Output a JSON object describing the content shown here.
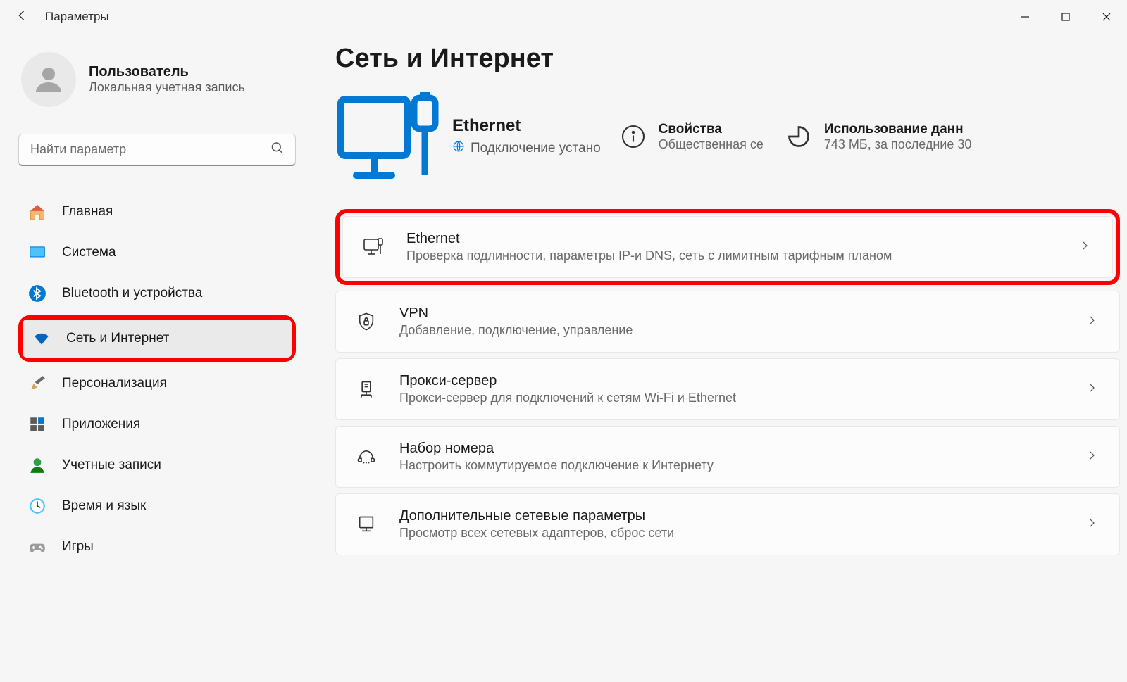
{
  "window": {
    "title": "Параметры"
  },
  "user": {
    "name": "Пользователь",
    "subtitle": "Локальная учетная запись"
  },
  "search": {
    "placeholder": "Найти параметр"
  },
  "nav": [
    {
      "label": "Главная",
      "icon": "home"
    },
    {
      "label": "Система",
      "icon": "system"
    },
    {
      "label": "Bluetooth и устройства",
      "icon": "bluetooth"
    },
    {
      "label": "Сеть и Интернет",
      "icon": "wifi",
      "active": true,
      "highlight": true
    },
    {
      "label": "Персонализация",
      "icon": "brush"
    },
    {
      "label": "Приложения",
      "icon": "apps"
    },
    {
      "label": "Учетные записи",
      "icon": "accounts"
    },
    {
      "label": "Время и язык",
      "icon": "time"
    },
    {
      "label": "Игры",
      "icon": "games"
    }
  ],
  "main": {
    "title": "Сеть и Интернет",
    "status": {
      "connection_title": "Ethernet",
      "connection_sub": "Подключение устано",
      "properties_title": "Свойства",
      "properties_sub": "Общественная се",
      "usage_title": "Использование данн",
      "usage_sub": "743 МБ, за последние 30"
    },
    "cards": [
      {
        "title": "Ethernet",
        "sub": "Проверка подлинности, параметры IP-и DNS, сеть с лимитным тарифным планом",
        "icon": "ethernet",
        "highlight": true
      },
      {
        "title": "VPN",
        "sub": "Добавление, подключение, управление",
        "icon": "vpn"
      },
      {
        "title": "Прокси-сервер",
        "sub": "Прокси-сервер для подключений к сетям Wi-Fi и Ethernet",
        "icon": "proxy"
      },
      {
        "title": "Набор номера",
        "sub": "Настроить коммутируемое подключение к Интернету",
        "icon": "dialup"
      },
      {
        "title": "Дополнительные сетевые параметры",
        "sub": "Просмотр всех сетевых адаптеров, сброс сети",
        "icon": "advanced"
      }
    ]
  }
}
